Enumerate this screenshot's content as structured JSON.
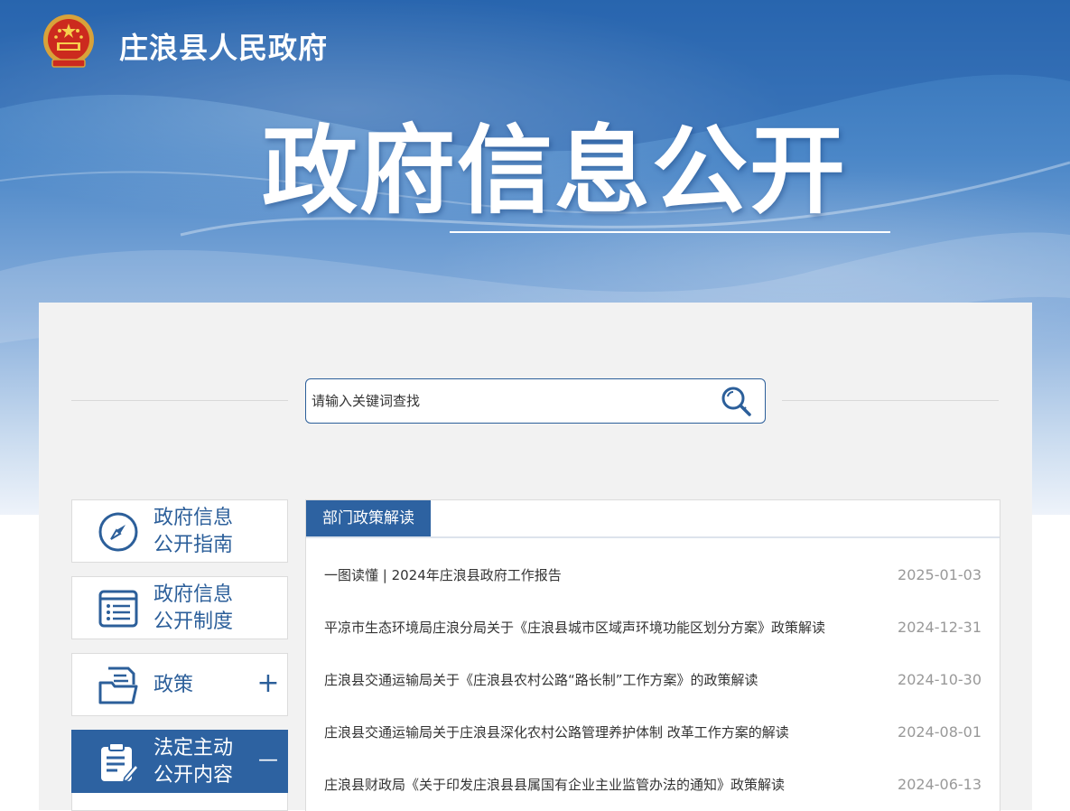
{
  "header": {
    "gov_name": "庄浪县人民政府",
    "hero_title": "政府信息公开"
  },
  "search": {
    "placeholder": "请输入关键词查找"
  },
  "sidebar": {
    "items": [
      {
        "line1": "政府信息",
        "line2": "公开指南"
      },
      {
        "line1": "政府信息",
        "line2": "公开制度"
      },
      {
        "label": "政策",
        "toggle": "+"
      },
      {
        "line1": "法定主动",
        "line2": "公开内容",
        "toggle": "—"
      }
    ]
  },
  "news": {
    "tab_label": "部门政策解读",
    "rows": [
      {
        "title": "一图读懂 | 2024年庄浪县政府工作报告",
        "date": "2025-01-03"
      },
      {
        "title": "平凉市生态环境局庄浪分局关于《庄浪县城市区域声环境功能区划分方案》政策解读",
        "date": "2024-12-31"
      },
      {
        "title": "庄浪县交通运输局关于《庄浪县农村公路“路长制”工作方案》的政策解读",
        "date": "2024-10-30"
      },
      {
        "title": "庄浪县交通运输局关于庄浪县深化农村公路管理养护体制 改革工作方案的解读",
        "date": "2024-08-01"
      },
      {
        "title": "庄浪县财政局《关于印发庄浪县县属国有企业主业监管办法的通知》政策解读",
        "date": "2024-06-13"
      }
    ]
  },
  "colors": {
    "primary": "#2d62a1",
    "panel_bg": "#f2f2f2",
    "date_gray": "#999999"
  }
}
